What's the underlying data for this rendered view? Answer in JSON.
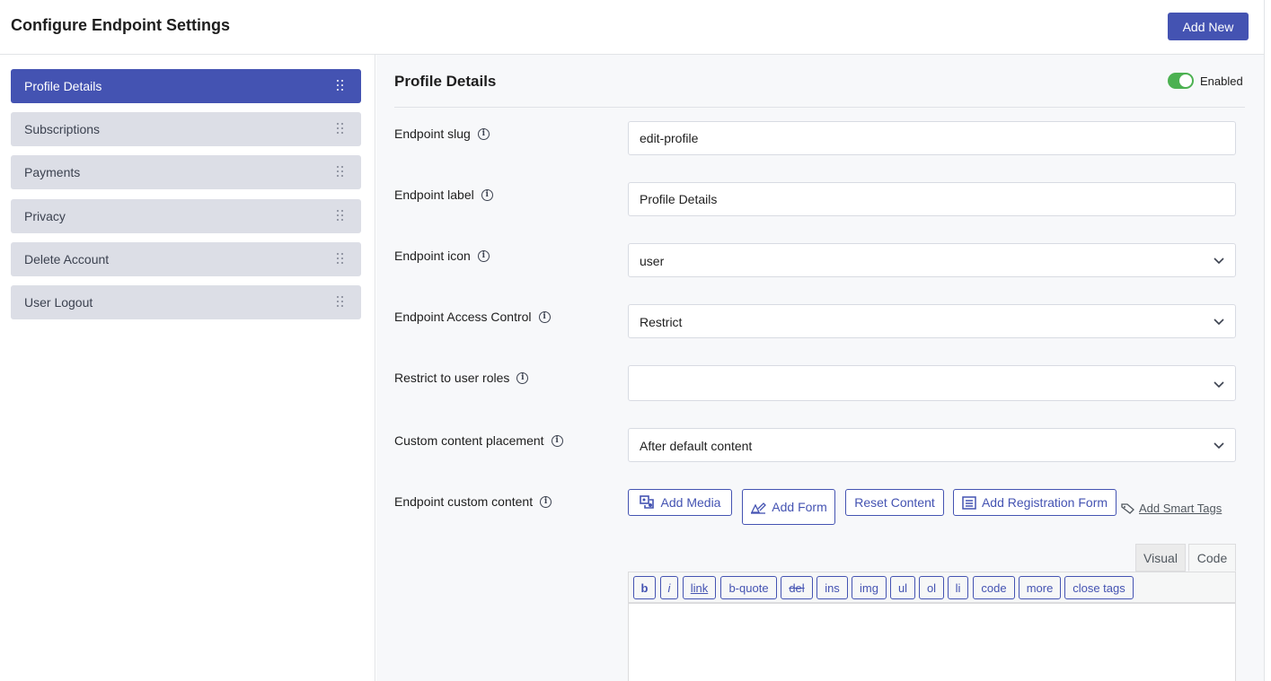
{
  "header": {
    "title": "Configure Endpoint Settings",
    "add_new_label": "Add New"
  },
  "sidebar": {
    "items": [
      {
        "label": "Profile Details",
        "active": true
      },
      {
        "label": "Subscriptions",
        "active": false
      },
      {
        "label": "Payments",
        "active": false
      },
      {
        "label": "Privacy",
        "active": false
      },
      {
        "label": "Delete Account",
        "active": false
      },
      {
        "label": "User Logout",
        "active": false
      }
    ]
  },
  "main": {
    "title": "Profile Details",
    "toggle": {
      "label": "Enabled",
      "on": true,
      "color": "#4cb151"
    },
    "fields": {
      "slug": {
        "label": "Endpoint slug",
        "value": "edit-profile"
      },
      "label": {
        "label": "Endpoint label",
        "value": "Profile Details"
      },
      "icon": {
        "label": "Endpoint icon",
        "value": "user"
      },
      "access": {
        "label": "Endpoint Access Control",
        "value": "Restrict"
      },
      "roles": {
        "label": "Restrict to user roles",
        "value": ""
      },
      "placement": {
        "label": "Custom content placement",
        "value": "After default content"
      },
      "content": {
        "label": "Endpoint custom content"
      }
    },
    "content_buttons": {
      "add_media": "Add Media",
      "add_form": "Add Form",
      "reset_content": "Reset Content",
      "add_registration_form": "Add Registration Form",
      "add_smart_tags": "Add Smart Tags"
    },
    "editor": {
      "tabs": {
        "visual": "Visual",
        "code": "Code"
      },
      "quicktags": [
        "b",
        "i",
        "link",
        "b-quote",
        "del",
        "ins",
        "img",
        "ul",
        "ol",
        "li",
        "code",
        "more",
        "close tags"
      ]
    }
  },
  "colors": {
    "accent": "#4453b2",
    "sidebar_inactive": "#dcdee6",
    "toggle_on": "#4cb151"
  }
}
